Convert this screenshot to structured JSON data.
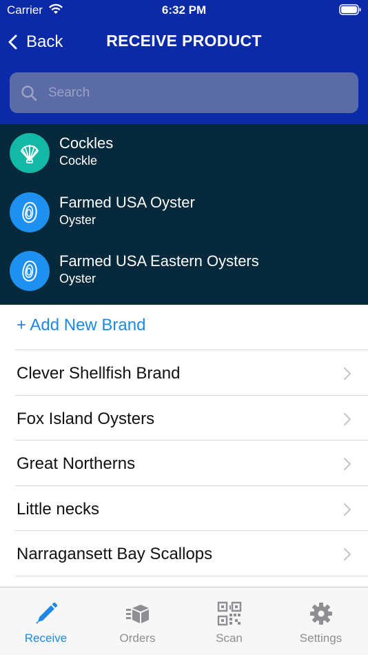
{
  "status_bar": {
    "carrier": "Carrier",
    "time": "6:32 PM"
  },
  "nav": {
    "back_label": "Back",
    "title": "RECEIVE PRODUCT"
  },
  "search": {
    "placeholder": "Search",
    "value": ""
  },
  "products": [
    {
      "name": "Cockles",
      "type": "Cockle",
      "icon": "shell-icon",
      "color": "#14b8a6"
    },
    {
      "name": "Farmed USA Oyster",
      "type": "Oyster",
      "icon": "oyster-icon",
      "color": "#1e90f0"
    },
    {
      "name": "Farmed USA Eastern Oysters",
      "type": "Oyster",
      "icon": "oyster-icon",
      "color": "#1e90f0"
    }
  ],
  "brands": {
    "add_label": "+ Add New Brand",
    "items": [
      {
        "label": "Clever Shellfish Brand"
      },
      {
        "label": "Fox Island Oysters"
      },
      {
        "label": "Great Northerns"
      },
      {
        "label": "Little necks"
      },
      {
        "label": "Narragansett Bay Scallops"
      }
    ]
  },
  "tabs": [
    {
      "label": "Receive",
      "icon": "pencil-icon",
      "active": true
    },
    {
      "label": "Orders",
      "icon": "orders-box-icon",
      "active": false
    },
    {
      "label": "Scan",
      "icon": "qr-code-icon",
      "active": false
    },
    {
      "label": "Settings",
      "icon": "gear-icon",
      "active": false
    }
  ],
  "colors": {
    "header": "#0a2aa8",
    "product_list_bg": "#06293b",
    "accent": "#1e88e5",
    "tab_inactive": "#8e8e93"
  }
}
